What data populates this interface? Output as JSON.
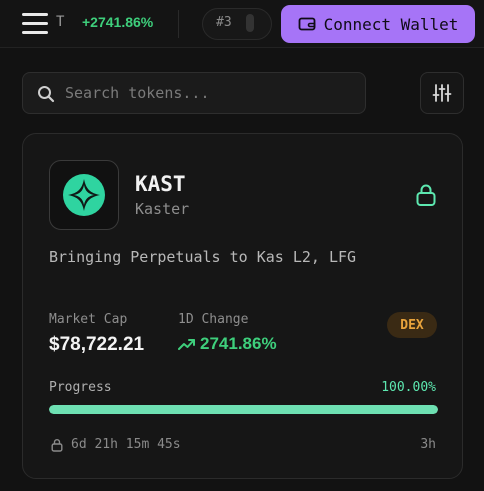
{
  "header": {
    "ticker_symbol": "T",
    "ticker_change": "+2741.86%",
    "ticker_rank": "#3",
    "connect_label": "Connect Wallet"
  },
  "search": {
    "placeholder": "Search tokens..."
  },
  "token": {
    "symbol": "KAST",
    "name": "Kaster",
    "description": "Bringing Perpetuals to Kas L2, LFG",
    "market_cap_label": "Market Cap",
    "market_cap_value": "$78,722.21",
    "change_label": "1D Change",
    "change_value": "2741.86%",
    "badge": "DEX",
    "progress_label": "Progress",
    "progress_text": "100.00%",
    "progress_fraction": 1.0,
    "timer": "6d 21h 15m 45s",
    "age": "3h"
  },
  "colors": {
    "accent": "#a674f7",
    "positive": "#3ecf7c",
    "progress": "#6ee0b2",
    "badge_text": "#e8a33c",
    "logo": "#2fd4a0"
  },
  "icons": {
    "menu": "hamburger-menu-icon",
    "wallet": "wallet-icon",
    "search": "search-icon",
    "filter": "sliders-icon",
    "lock": "lock-icon",
    "trend": "trending-up-icon",
    "logo": "four-point-star-logo"
  }
}
